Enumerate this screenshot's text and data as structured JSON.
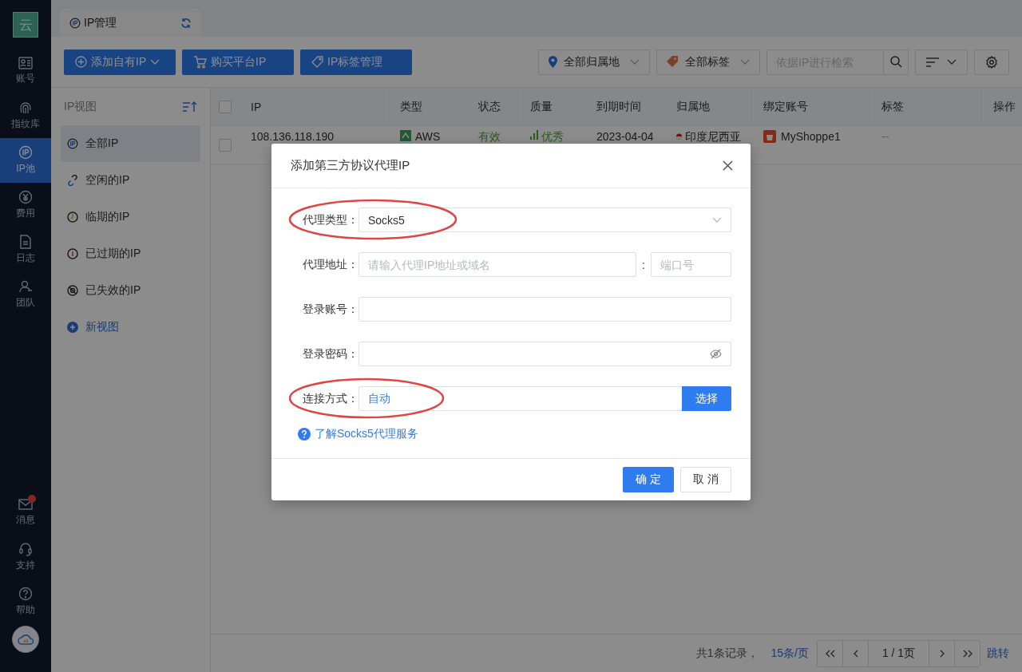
{
  "nav": {
    "logo": "云",
    "items": [
      {
        "label": "账号",
        "selected": false
      },
      {
        "label": "指纹库",
        "selected": false
      },
      {
        "label": "IP池",
        "selected": true
      },
      {
        "label": "费用",
        "selected": false
      },
      {
        "label": "日志",
        "selected": false
      },
      {
        "label": "团队",
        "selected": false
      }
    ],
    "bottom_items": [
      {
        "label": "消息",
        "badge": true
      },
      {
        "label": "支持",
        "badge": false
      },
      {
        "label": "帮助",
        "badge": false
      }
    ]
  },
  "tab": {
    "label": "IP管理"
  },
  "toolbar": {
    "buttons": [
      "添加自有IP",
      "购买平台IP",
      "IP标签管理"
    ],
    "location_filter": "全部归属地",
    "tag_filter": "全部标签",
    "search": {
      "placeholder": "依据IP进行检索"
    }
  },
  "views": {
    "title": "IP视图",
    "items": [
      {
        "label": "全部IP",
        "selected": true
      },
      {
        "label": "空闲的IP",
        "selected": false
      },
      {
        "label": "临期的IP",
        "selected": false
      },
      {
        "label": "已过期的IP",
        "selected": false
      },
      {
        "label": "已失效的IP",
        "selected": false
      }
    ],
    "new_view": "新视图"
  },
  "table": {
    "all_checked": false,
    "columns": [
      "IP",
      "类型",
      "状态",
      "质量",
      "到期时间",
      "归属地",
      "绑定账号",
      "标签",
      "操作"
    ],
    "rows": [
      {
        "checked": false,
        "cells": [
          "108.136.118.190",
          "AWS",
          "有效",
          "优秀",
          "2023-04-04",
          "印度尼西亚",
          "MyShoppe1",
          "--"
        ]
      }
    ]
  },
  "pagination": {
    "summary": "共1条记录，",
    "page_size": "15条/页",
    "page": "1 / 1页",
    "jump": "跳转"
  },
  "dialog": {
    "title": "添加第三方协议代理IP",
    "fields": [
      {
        "kind": "select",
        "label": "代理类型：",
        "value": "Socks5",
        "highlighted": true
      },
      {
        "kind": "address",
        "label": "代理地址：",
        "placeholder": "请输入代理IP地址或域名",
        "separator": ":",
        "port_placeholder": "端口号",
        "highlighted": false
      },
      {
        "kind": "text",
        "label": "登录账号：",
        "highlighted": false
      },
      {
        "kind": "password",
        "label": "登录密码：",
        "highlighted": false
      },
      {
        "kind": "choice",
        "label": "连接方式：",
        "value": "自动",
        "button": "选择",
        "highlighted": true
      }
    ],
    "help_link": "了解Socks5代理服务",
    "confirm": "确 定",
    "cancel": "取 消"
  }
}
